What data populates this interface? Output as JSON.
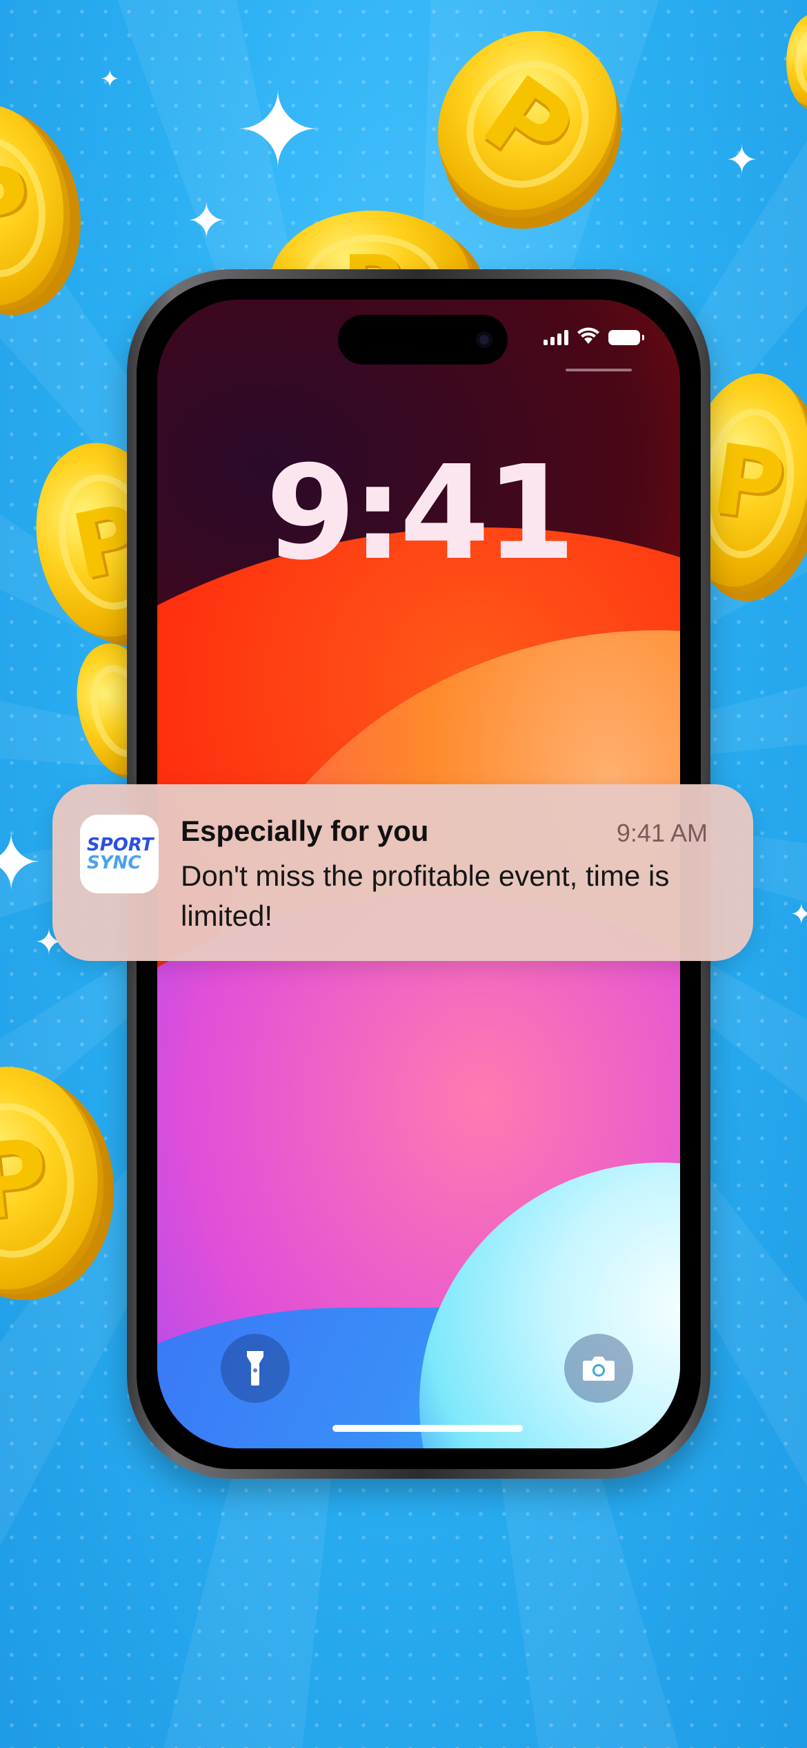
{
  "lock_screen": {
    "time": "9:41"
  },
  "notification": {
    "app_icon_text_line1": "SPORT",
    "app_icon_text_line2": "SYNC",
    "title": "Especially for you",
    "time": "9:41 AM",
    "body": "Don't miss the profitable event, time is limited!"
  },
  "coin_letter": "P",
  "colors": {
    "background": "#2bb0f3",
    "coin": "#ffd21f",
    "brand_blue": "#2b4fe0",
    "brand_light_blue": "#4aa2f0"
  },
  "icons": {
    "flashlight": "flashlight-icon",
    "camera": "camera-icon"
  }
}
